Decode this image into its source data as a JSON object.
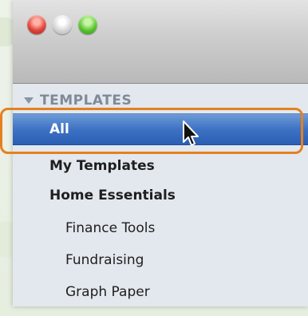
{
  "window": {
    "controls": [
      "close",
      "minimize",
      "zoom"
    ]
  },
  "sidebar": {
    "section_title": "TEMPLATES",
    "items": [
      {
        "label": "All",
        "selected": true,
        "bold": true,
        "level": 0
      },
      {
        "label": "My Templates",
        "selected": false,
        "bold": true,
        "level": 0
      },
      {
        "label": "Home Essentials",
        "selected": false,
        "bold": true,
        "level": 0
      },
      {
        "label": "Finance Tools",
        "selected": false,
        "bold": false,
        "level": 1
      },
      {
        "label": "Fundraising",
        "selected": false,
        "bold": false,
        "level": 1
      },
      {
        "label": "Graph Paper",
        "selected": false,
        "bold": false,
        "level": 1
      }
    ]
  },
  "colors": {
    "selection": "#3e72c4",
    "highlight_outline": "#e6801f",
    "section_header": "#7f8a99"
  },
  "icons": {
    "cursor": "arrow-cursor-icon",
    "disclosure": "disclosure-triangle-icon"
  }
}
